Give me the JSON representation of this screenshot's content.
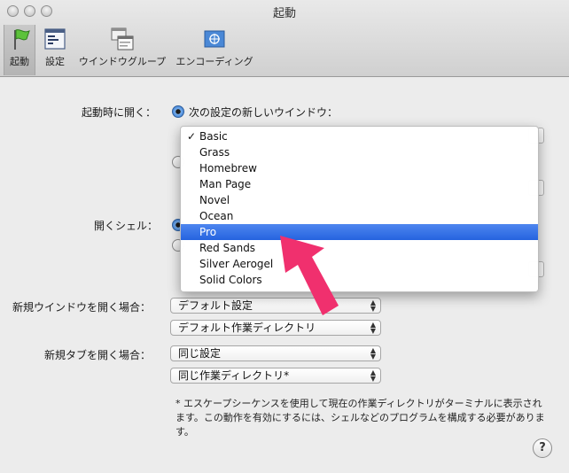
{
  "window": {
    "title": "起動"
  },
  "toolbar": {
    "items": [
      {
        "label": "起動",
        "icon": "flag-icon"
      },
      {
        "label": "設定",
        "icon": "settings-window-icon"
      },
      {
        "label": "ウインドウグループ",
        "icon": "window-group-icon"
      },
      {
        "label": "エンコーディング",
        "icon": "encoding-flag-icon"
      }
    ]
  },
  "form": {
    "startup_label": "起動時に開く：",
    "startup_option": "次の設定の新しいウインドウ：",
    "shell_label": "開くシェル：",
    "new_window_label": "新規ウインドウを開く場合：",
    "new_window_profile": "デフォルト設定",
    "new_window_dir": "デフォルト作業ディレクトリ",
    "new_tab_label": "新規タブを開く場合：",
    "new_tab_profile": "同じ設定",
    "new_tab_dir": "同じ作業ディレクトリ*",
    "note": "* エスケープシーケンスを使用して現在の作業ディレクトリがターミナルに表示されます。この動作を有効にするには、シェルなどのプログラムを構成する必要があります。",
    "help": "?"
  },
  "menu": {
    "items": [
      {
        "label": "Basic",
        "checked": true
      },
      {
        "label": "Grass"
      },
      {
        "label": "Homebrew"
      },
      {
        "label": "Man Page"
      },
      {
        "label": "Novel"
      },
      {
        "label": "Ocean"
      },
      {
        "label": "Pro",
        "highlighted": true
      },
      {
        "label": "Red Sands"
      },
      {
        "label": "Silver Aerogel"
      },
      {
        "label": "Solid Colors"
      }
    ],
    "check_mark": "✓"
  },
  "colors": {
    "highlight": "#2563df",
    "arrow": "#f0306e"
  }
}
